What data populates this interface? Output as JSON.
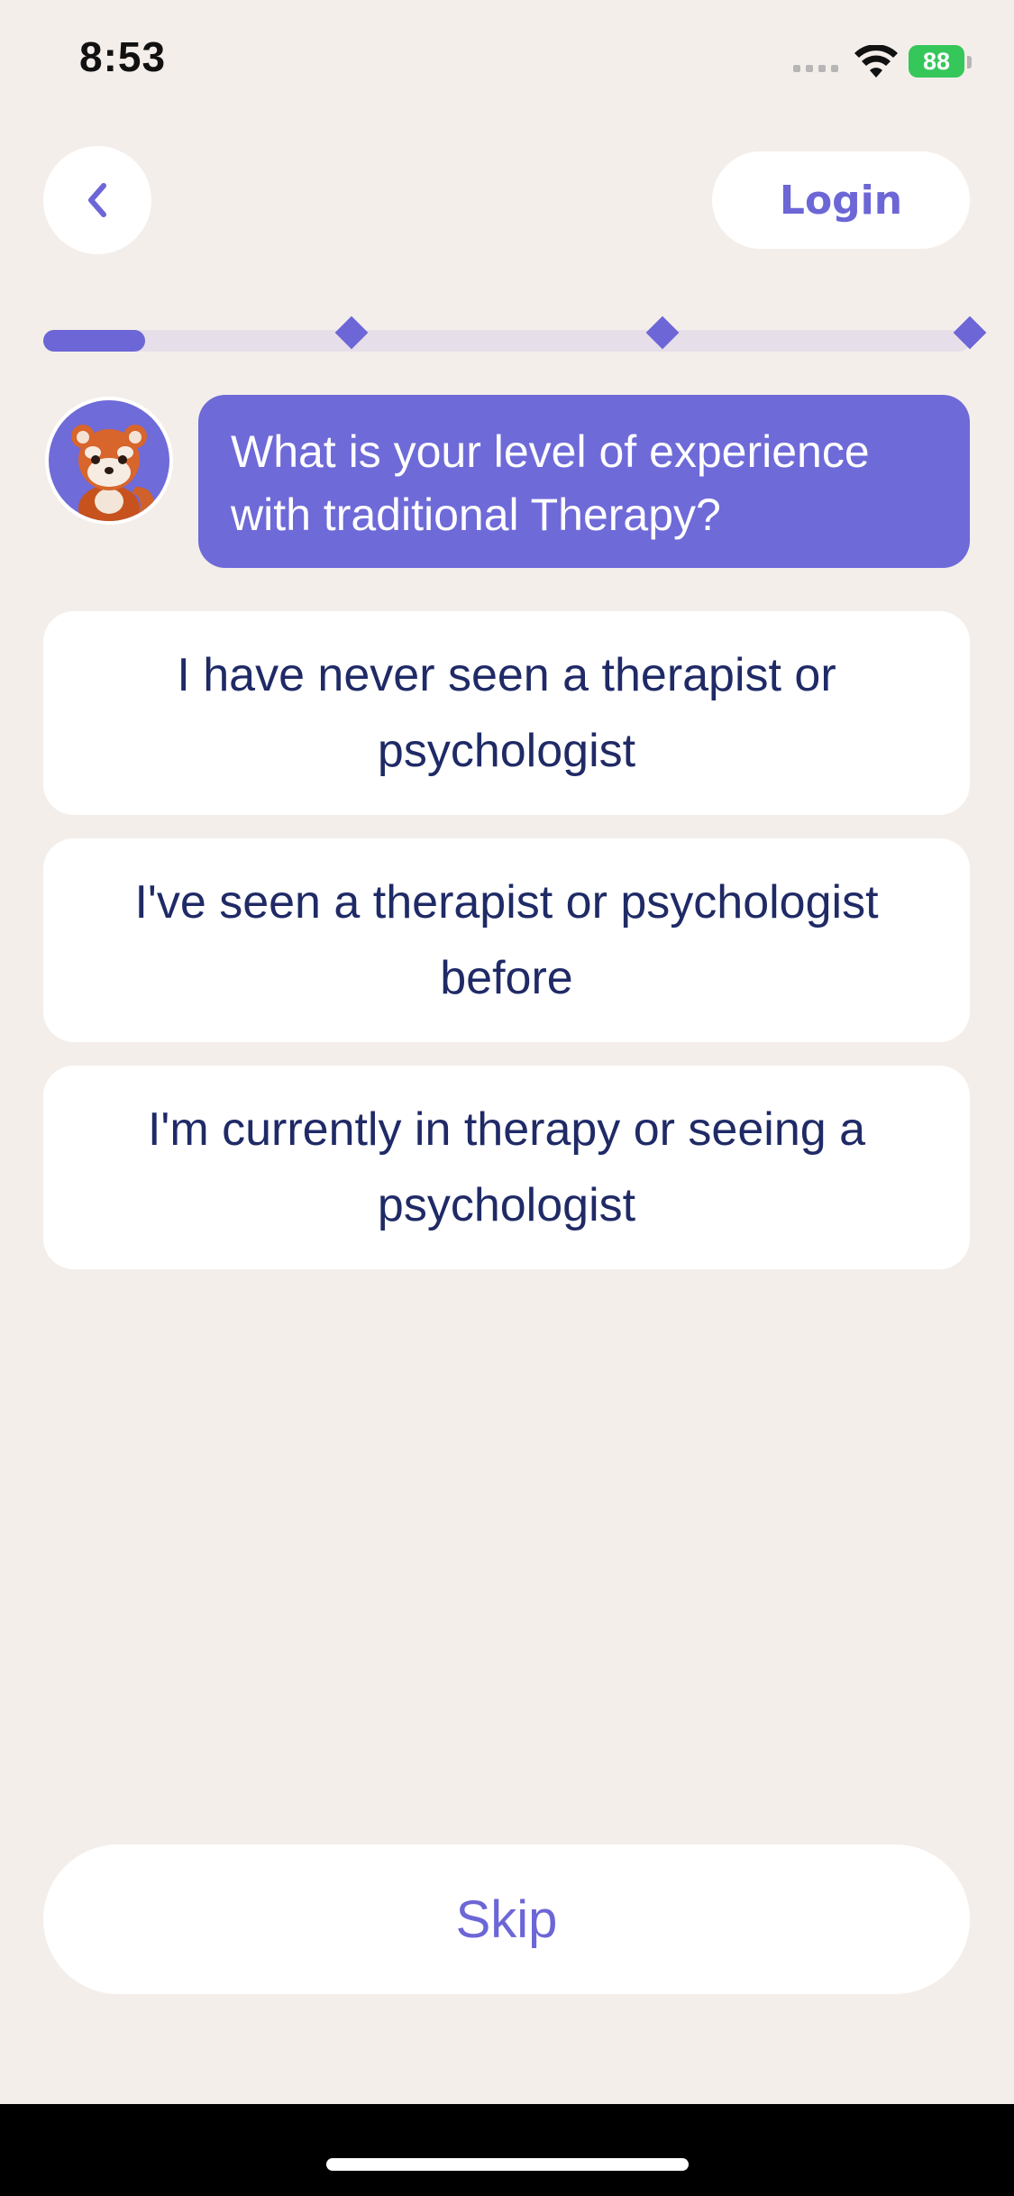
{
  "status_bar": {
    "time": "8:53",
    "battery": "88",
    "battery_color": "#35C759",
    "icons": [
      "cellular-signal-icon",
      "wifi-icon",
      "battery-charging-icon"
    ]
  },
  "header": {
    "back_icon": "chevron-left-icon",
    "login_label": "Login"
  },
  "progress": {
    "fraction": 0.11,
    "milestones": 3,
    "accent": "#6C66D6"
  },
  "question": {
    "avatar": "red-panda-avatar",
    "text": "What is your level of experience with traditional Therapy?"
  },
  "options": [
    {
      "label": "I have never seen a therapist or psychologist"
    },
    {
      "label": "I've seen a therapist or psychologist before"
    },
    {
      "label": "I'm currently in therapy or seeing a psychologist"
    }
  ],
  "footer": {
    "skip_label": "Skip"
  }
}
